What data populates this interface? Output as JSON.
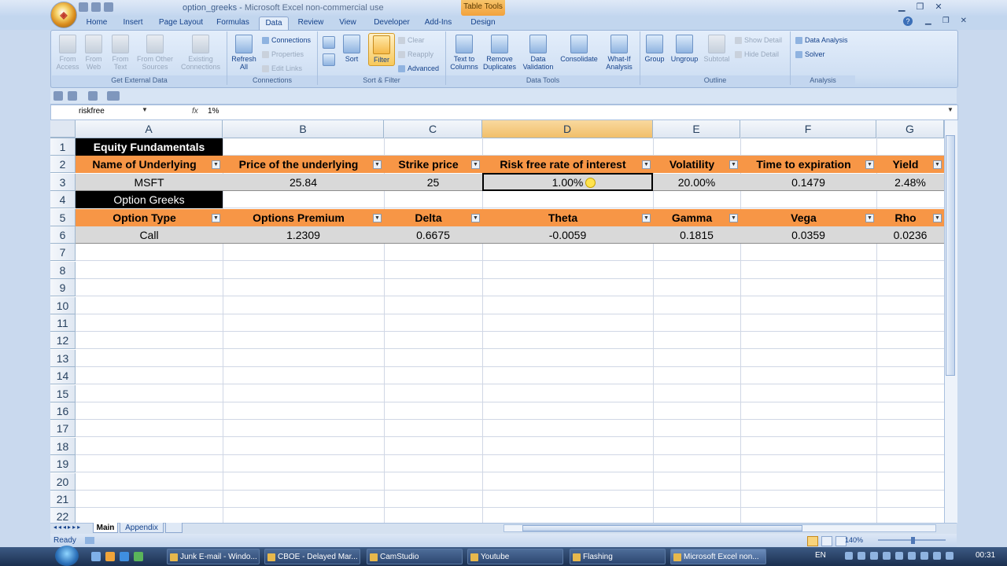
{
  "window": {
    "file_name": "option_greeks",
    "separator": " - ",
    "app_name": "Microsoft Excel non-commercial use",
    "context_tab": "Table Tools"
  },
  "tabs": [
    "Home",
    "Insert",
    "Page Layout",
    "Formulas",
    "Data",
    "Review",
    "View",
    "Developer",
    "Add-Ins",
    "Design"
  ],
  "active_tab": "Data",
  "ribbon": {
    "get_external_data": {
      "label": "Get External Data",
      "buttons": [
        "From Access",
        "From Web",
        "From Text",
        "From Other Sources",
        "Existing Connections"
      ]
    },
    "connections": {
      "label": "Connections",
      "refresh": "Refresh All",
      "small": [
        "Connections",
        "Properties",
        "Edit Links"
      ]
    },
    "sort_filter": {
      "label": "Sort & Filter",
      "sort": "Sort",
      "filter": "Filter",
      "small": [
        "Clear",
        "Reapply",
        "Advanced"
      ]
    },
    "data_tools": {
      "label": "Data Tools",
      "buttons": [
        "Text to Columns",
        "Remove Duplicates",
        "Data Validation",
        "Consolidate",
        "What-If Analysis"
      ]
    },
    "outline": {
      "label": "Outline",
      "buttons": [
        "Group",
        "Ungroup",
        "Subtotal"
      ],
      "small": [
        "Show Detail",
        "Hide Detail"
      ]
    },
    "analysis": {
      "label": "Analysis",
      "small": [
        "Data Analysis",
        "Solver"
      ]
    }
  },
  "formula_bar": {
    "name_box": "riskfree",
    "fx": "fx",
    "value": "1%"
  },
  "columns": [
    "A",
    "B",
    "C",
    "D",
    "E",
    "F",
    "G"
  ],
  "rows": [
    "1",
    "2",
    "3",
    "4",
    "5",
    "6",
    "7",
    "8",
    "9",
    "10",
    "11",
    "12",
    "13",
    "14",
    "15",
    "16",
    "17",
    "18",
    "19",
    "20",
    "21",
    "22"
  ],
  "sheet": {
    "equity_title": "Equity Fundamentals",
    "equity_headers": [
      "Name of Underlying",
      "Price of the underlying",
      "Strike price",
      "Risk free rate of interest",
      "Volatility",
      "Time to expiration",
      "Yield"
    ],
    "equity_values": [
      "MSFT",
      "25.84",
      "25",
      "1.00%",
      "20.00%",
      "0.1479",
      "2.48%"
    ],
    "greeks_title": "Option Greeks",
    "greeks_headers": [
      "Option Type",
      "Options Premium",
      "Delta",
      "Theta",
      "Gamma",
      "Vega",
      "Rho"
    ],
    "greeks_values": [
      "Call",
      "1.2309",
      "0.6675",
      "-0.0059",
      "0.1815",
      "0.0359",
      "0.0236"
    ]
  },
  "sheet_tabs": [
    "Main",
    "Appendix"
  ],
  "status": {
    "ready": "Ready",
    "zoom": "140%"
  },
  "taskbar": {
    "items": [
      "Junk E-mail - Windo...",
      "CBOE - Delayed Mar...",
      "CamStudio",
      "Youtube",
      "Flashing",
      "Microsoft Excel non..."
    ],
    "lang": "EN",
    "clock": "00:31"
  },
  "colors": {
    "orange": "#f79646",
    "black": "#000000",
    "grey_band": "#d9d9d9",
    "selected_col": "#f1bf6a"
  }
}
